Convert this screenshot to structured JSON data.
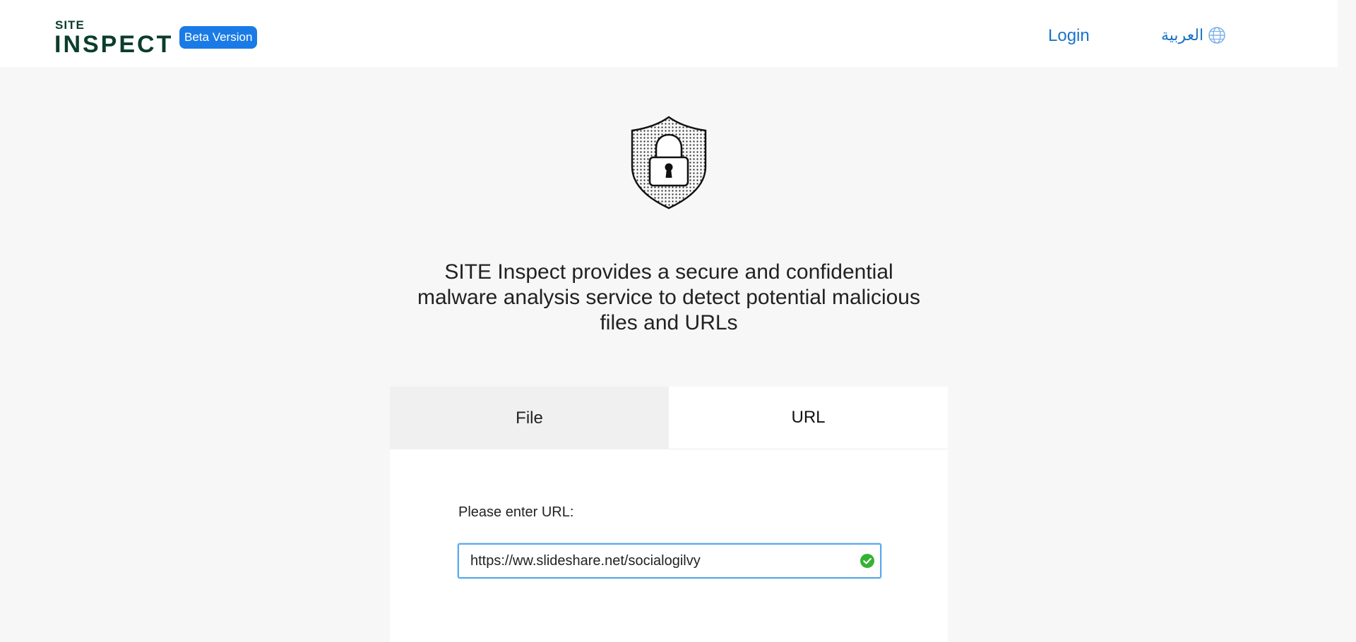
{
  "header": {
    "logo": {
      "top_word": "SITE",
      "main_word": "INSPECT"
    },
    "badge": "Beta Version",
    "login_label": "Login",
    "language_label": "العربية",
    "language_icon": "globe-icon"
  },
  "hero": {
    "icon": "shield-lock-icon",
    "tagline_line1": "SITE Inspect provides a secure and confidential",
    "tagline_line2": "malware analysis service to detect potential malicious",
    "tagline_line3": "files and URLs"
  },
  "tabs": {
    "items": [
      {
        "label": "File",
        "active": false
      },
      {
        "label": "URL",
        "active": true
      }
    ]
  },
  "url_form": {
    "label": "Please enter URL:",
    "value": "https://ww.slideshare.net/socialogilvy",
    "validation_icon": "check-circle-icon",
    "validation_state": "valid"
  },
  "colors": {
    "brand_dark": "#0b3d2c",
    "accent_blue": "#1a7be6",
    "link_blue": "#1a73c7",
    "focus_border": "#5aa9ec",
    "valid_green": "#34b233",
    "page_bg": "#f7f7f7"
  }
}
